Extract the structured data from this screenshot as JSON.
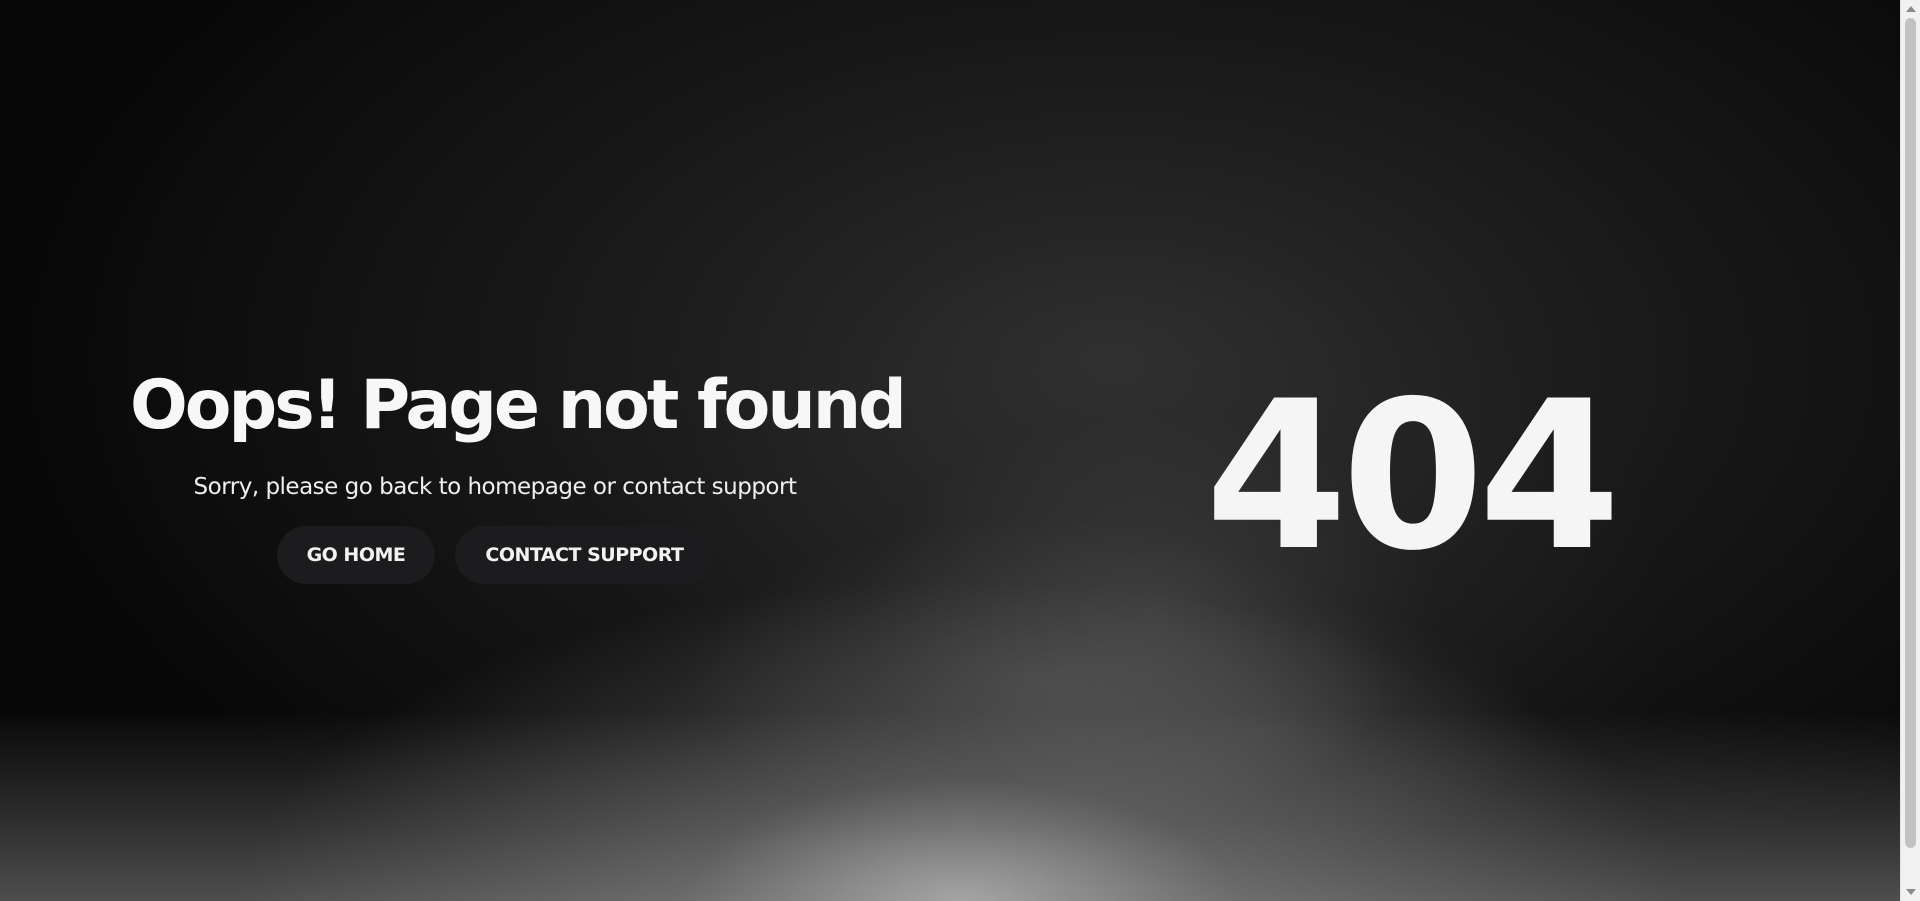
{
  "error": {
    "title": "Oops! Page not found",
    "message": "Sorry, please go back to homepage or contact support",
    "code": "404"
  },
  "actions": {
    "go_home_label": "GO HOME",
    "contact_support_label": "CONTACT SUPPORT"
  },
  "colors": {
    "text": "#f7f7f7",
    "button_background": "#1c1c1e",
    "page_background": "#0a0a0a"
  }
}
